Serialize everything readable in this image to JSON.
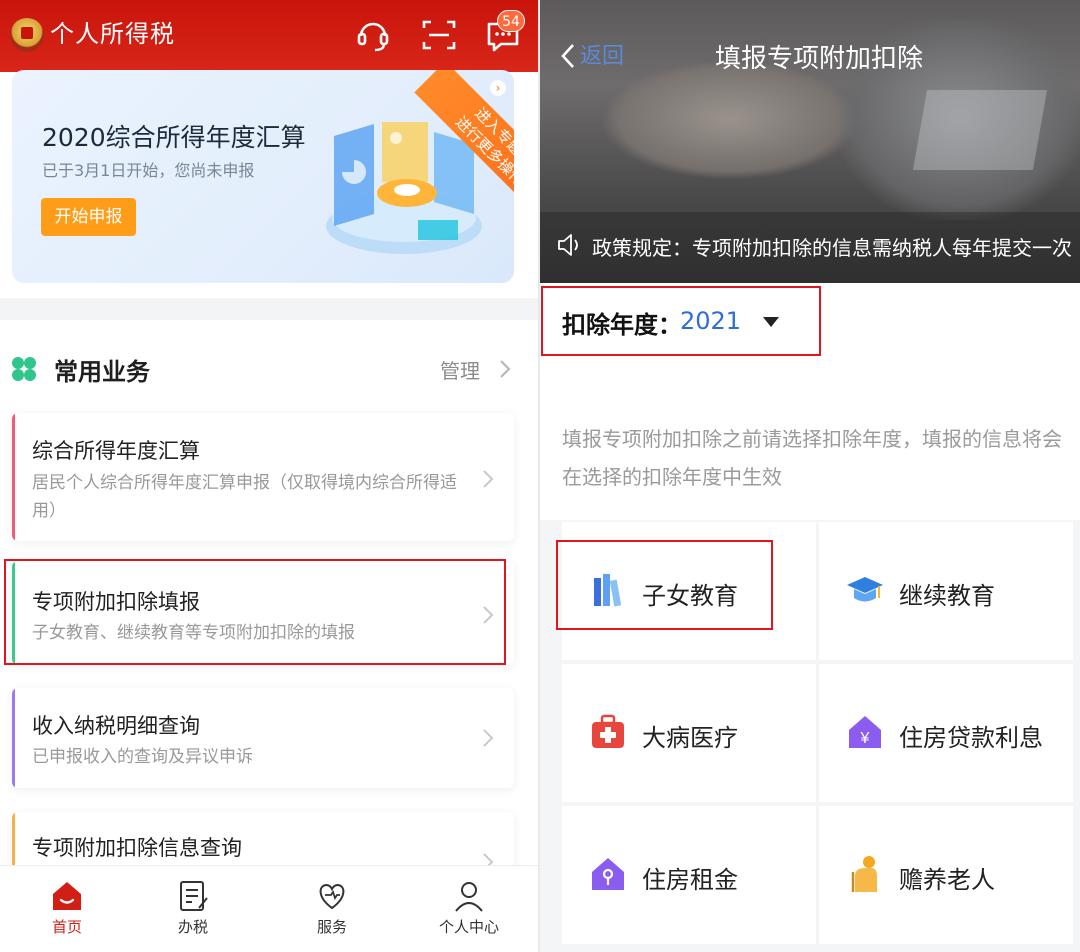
{
  "left": {
    "app_title": "个人所得税",
    "badge_count": "54",
    "banner": {
      "title": "2020综合所得年度汇算",
      "subtitle": "已于3月1日开始，您尚未申报",
      "button": "开始申报",
      "ribbon_line1": "进入专题页",
      "ribbon_line2": "进行更多操作"
    },
    "section": {
      "title": "常用业务",
      "manage": "管理"
    },
    "cards": [
      {
        "title": "综合所得年度汇算",
        "desc": "居民个人综合所得年度汇算申报（仅取得境内综合所得适用）",
        "accent": "#f05b7a"
      },
      {
        "title": "专项附加扣除填报",
        "desc": "子女教育、继续教育等专项附加扣除的填报",
        "accent": "#3cc98b"
      },
      {
        "title": "收入纳税明细查询",
        "desc": "已申报收入的查询及异议申诉",
        "accent": "#9a7cf0"
      },
      {
        "title": "专项附加扣除信息查询",
        "desc": "",
        "accent": "#f6b04a"
      }
    ],
    "tabs": [
      {
        "label": "首页",
        "icon": "home-icon",
        "active": true
      },
      {
        "label": "办税",
        "icon": "tax-form-icon",
        "active": false
      },
      {
        "label": "服务",
        "icon": "service-heart-icon",
        "active": false
      },
      {
        "label": "个人中心",
        "icon": "user-icon",
        "active": false
      }
    ],
    "colors": {
      "brand_red": "#d11f15",
      "banner_button": "#ff9d18"
    }
  },
  "right": {
    "back": "返回",
    "title": "填报专项附加扣除",
    "notice": "政策规定：专项附加扣除的信息需纳税人每年提交一次",
    "year_label": "扣除年度：",
    "year_value": "2021",
    "hint": "填报专项附加扣除之前请选择扣除年度，填报的信息将会在选择的扣除年度中生效",
    "categories": [
      {
        "label": "子女教育",
        "icon": "books-icon"
      },
      {
        "label": "继续教育",
        "icon": "graduation-cap-icon"
      },
      {
        "label": "大病医疗",
        "icon": "medical-kit-icon"
      },
      {
        "label": "住房贷款利息",
        "icon": "house-yuan-icon"
      },
      {
        "label": "住房租金",
        "icon": "house-key-icon"
      },
      {
        "label": "赡养老人",
        "icon": "elderly-person-icon"
      }
    ],
    "colors": {
      "link_blue": "#2e6dd8",
      "highlight_red": "#e0161e"
    }
  }
}
